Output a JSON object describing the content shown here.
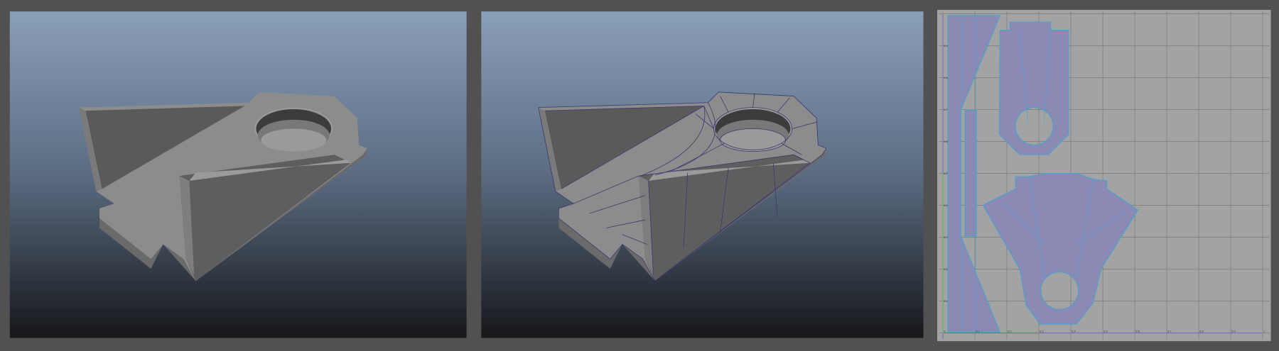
{
  "panels": [
    {
      "name": "shaded-viewport",
      "mode": "smooth shaded"
    },
    {
      "name": "wireframe-on-shaded-viewport",
      "mode": "wireframe on shaded"
    },
    {
      "name": "uv-editor",
      "mode": "uv layout"
    }
  ],
  "uv_editor": {
    "u_ticks": [
      "0",
      "0.1",
      "0.2",
      "0.3",
      "0.4",
      "0.5",
      "0.6",
      "0.7",
      "0.8",
      "0.9",
      "1"
    ],
    "v_ticks": [
      "0.1",
      "0.2",
      "0.3",
      "0.4",
      "0.5",
      "0.6",
      "0.7",
      "0.8",
      "0.9"
    ]
  },
  "colors": {
    "background": "#515151",
    "viewport_top": "#8a9fb8",
    "viewport_bottom": "#16171a",
    "mesh": "#8a8a8a",
    "wire": "#3a3a70",
    "uv_bg": "#a3a3a3",
    "uv_shell_fill": "#8a8ab4",
    "uv_edge": "#4aa3cc"
  }
}
